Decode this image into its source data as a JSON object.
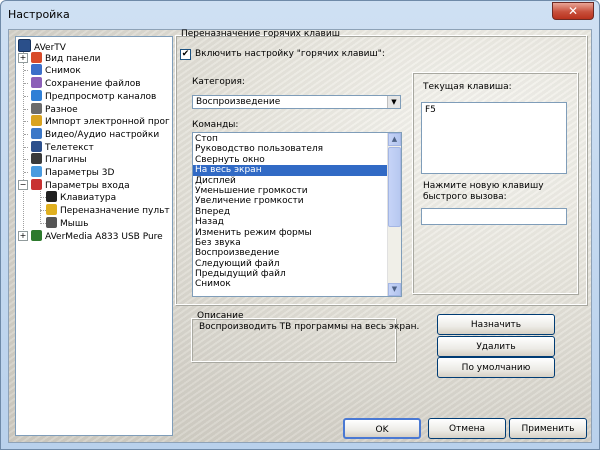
{
  "window": {
    "title": "Настройка",
    "close_glyph": "✕"
  },
  "tree": {
    "root": "AVerTV",
    "items": [
      {
        "label": "Вид панели",
        "expander": "+",
        "icon": "display-panel-icon",
        "color": "#d84b2a"
      },
      {
        "label": "Снимок",
        "expander": "",
        "icon": "camera-icon",
        "color": "#3b6fc9"
      },
      {
        "label": "Сохранение файлов",
        "expander": "",
        "icon": "save-file-icon",
        "color": "#8c5fb8"
      },
      {
        "label": "Предпросмотр каналов",
        "expander": "",
        "icon": "eye-icon",
        "color": "#2f7fd6"
      },
      {
        "label": "Разное",
        "expander": "",
        "icon": "misc-icon",
        "color": "#6c6c6c"
      },
      {
        "label": "Импорт электронной прог",
        "expander": "",
        "icon": "import-icon",
        "color": "#d9a321"
      },
      {
        "label": "Видео/Аудио настройки",
        "expander": "",
        "icon": "tools-icon",
        "color": "#3c78c8"
      },
      {
        "label": "Телетекст",
        "expander": "",
        "icon": "teletext-icon",
        "color": "#2c4f8c"
      },
      {
        "label": "Плагины",
        "expander": "",
        "icon": "plugin-icon",
        "color": "#3a3a3a"
      },
      {
        "label": "Параметры 3D",
        "expander": "",
        "icon": "3d-settings-icon",
        "color": "#4a9be0"
      },
      {
        "label": "Параметры входа",
        "expander": "−",
        "icon": "input-settings-icon",
        "color": "#c83232"
      },
      {
        "label": "Клавиатура",
        "expander": "",
        "icon": "keyboard-icon",
        "color": "#202020",
        "child": true
      },
      {
        "label": "Переназначение пульт",
        "expander": "",
        "icon": "remote-icon",
        "color": "#e0b020",
        "child": true
      },
      {
        "label": "Мышь",
        "expander": "",
        "icon": "mouse-icon",
        "color": "#555555",
        "child": true
      },
      {
        "label": "AVerMedia A833 USB Pure",
        "expander": "+",
        "icon": "tuner-device-icon",
        "color": "#2d7a2d"
      }
    ]
  },
  "hotkeys": {
    "group_title": "Переназначение горячих клавиш",
    "enable_label": "Включить настройку \"горячих клавиш\":",
    "enable_mark": "✔",
    "category_label": "Категория:",
    "category_value": "Воспроизведение",
    "commands_label": "Команды:",
    "commands": [
      "Стоп",
      "Руководство пользователя",
      "Свернуть окно",
      "На весь экран",
      "Дисплей",
      "Уменьшение громкости",
      "Увеличение громкости",
      "Вперед",
      "Назад",
      "Изменить режим формы",
      "Без звука",
      "Воспроизведение",
      "Следующий файл",
      "Предыдущий файл",
      "Снимок"
    ],
    "selected_index": 3,
    "current_key_label": "Текущая клавиша:",
    "current_key_value": "F5",
    "new_key_label": "Нажмите новую клавишу быстрого вызова:",
    "new_key_value": ""
  },
  "description": {
    "title": "Описание",
    "text": "Воспроизводить ТВ программы на весь экран."
  },
  "buttons": {
    "assign": "Назначить",
    "delete": "Удалить",
    "defaults": "По умолчанию",
    "ok": "OK",
    "cancel": "Отмена",
    "apply": "Применить"
  }
}
